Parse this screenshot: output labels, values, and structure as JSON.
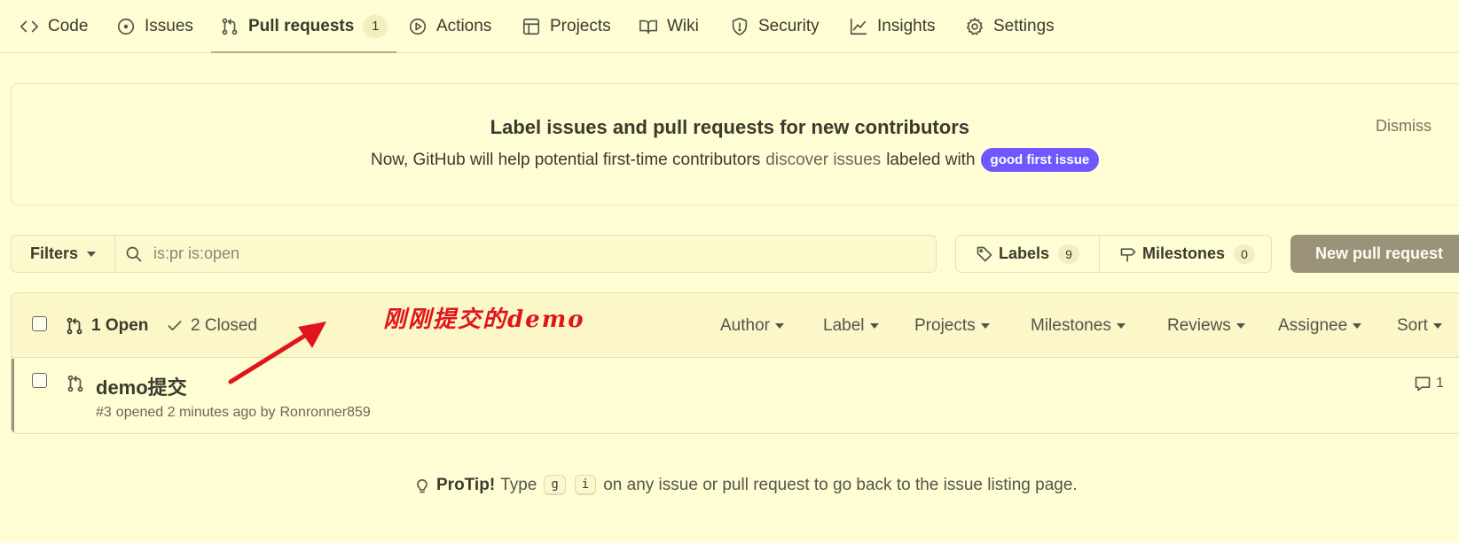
{
  "nav": {
    "tabs": [
      {
        "label": "Code",
        "icon": "code-icon"
      },
      {
        "label": "Issues",
        "icon": "issue-opened-icon"
      },
      {
        "label": "Pull requests",
        "icon": "git-pull-request-icon",
        "count": "1",
        "active": true
      },
      {
        "label": "Actions",
        "icon": "play-icon"
      },
      {
        "label": "Projects",
        "icon": "table-icon"
      },
      {
        "label": "Wiki",
        "icon": "book-icon"
      },
      {
        "label": "Security",
        "icon": "shield-icon"
      },
      {
        "label": "Insights",
        "icon": "graph-icon"
      },
      {
        "label": "Settings",
        "icon": "gear-icon"
      }
    ]
  },
  "banner": {
    "title": "Label issues and pull requests for new contributors",
    "text_before": "Now, GitHub will help potential first-time contributors",
    "link": "discover issues",
    "text_after": "labeled with",
    "label_badge": "good first issue",
    "label_color": "#7057ff",
    "dismiss": "Dismiss"
  },
  "filters": {
    "button": "Filters",
    "search_placeholder": "is:pr is:open",
    "labels": "Labels",
    "labels_count": "9",
    "milestones": "Milestones",
    "milestones_count": "0",
    "new_pr": "New pull request"
  },
  "list": {
    "open": "1 Open",
    "closed": "2 Closed",
    "sort_menus": [
      "Author",
      "Label",
      "Projects",
      "Milestones",
      "Reviews",
      "Assignee",
      "Sort"
    ],
    "items": [
      {
        "title": "demo提交",
        "number": "#3",
        "opened": "opened 2 minutes ago by",
        "author": "Ronronner859",
        "comments": "1"
      }
    ]
  },
  "annotation": {
    "text": "刚刚提交的demo",
    "color": "#e2141b"
  },
  "protip": {
    "label": "ProTip!",
    "before": "Type",
    "key1": "g",
    "key2": "i",
    "after": "on any issue or pull request to go back to the issue listing page."
  },
  "colors": {
    "background": "#fffdd4",
    "accent": "#9a937a"
  }
}
